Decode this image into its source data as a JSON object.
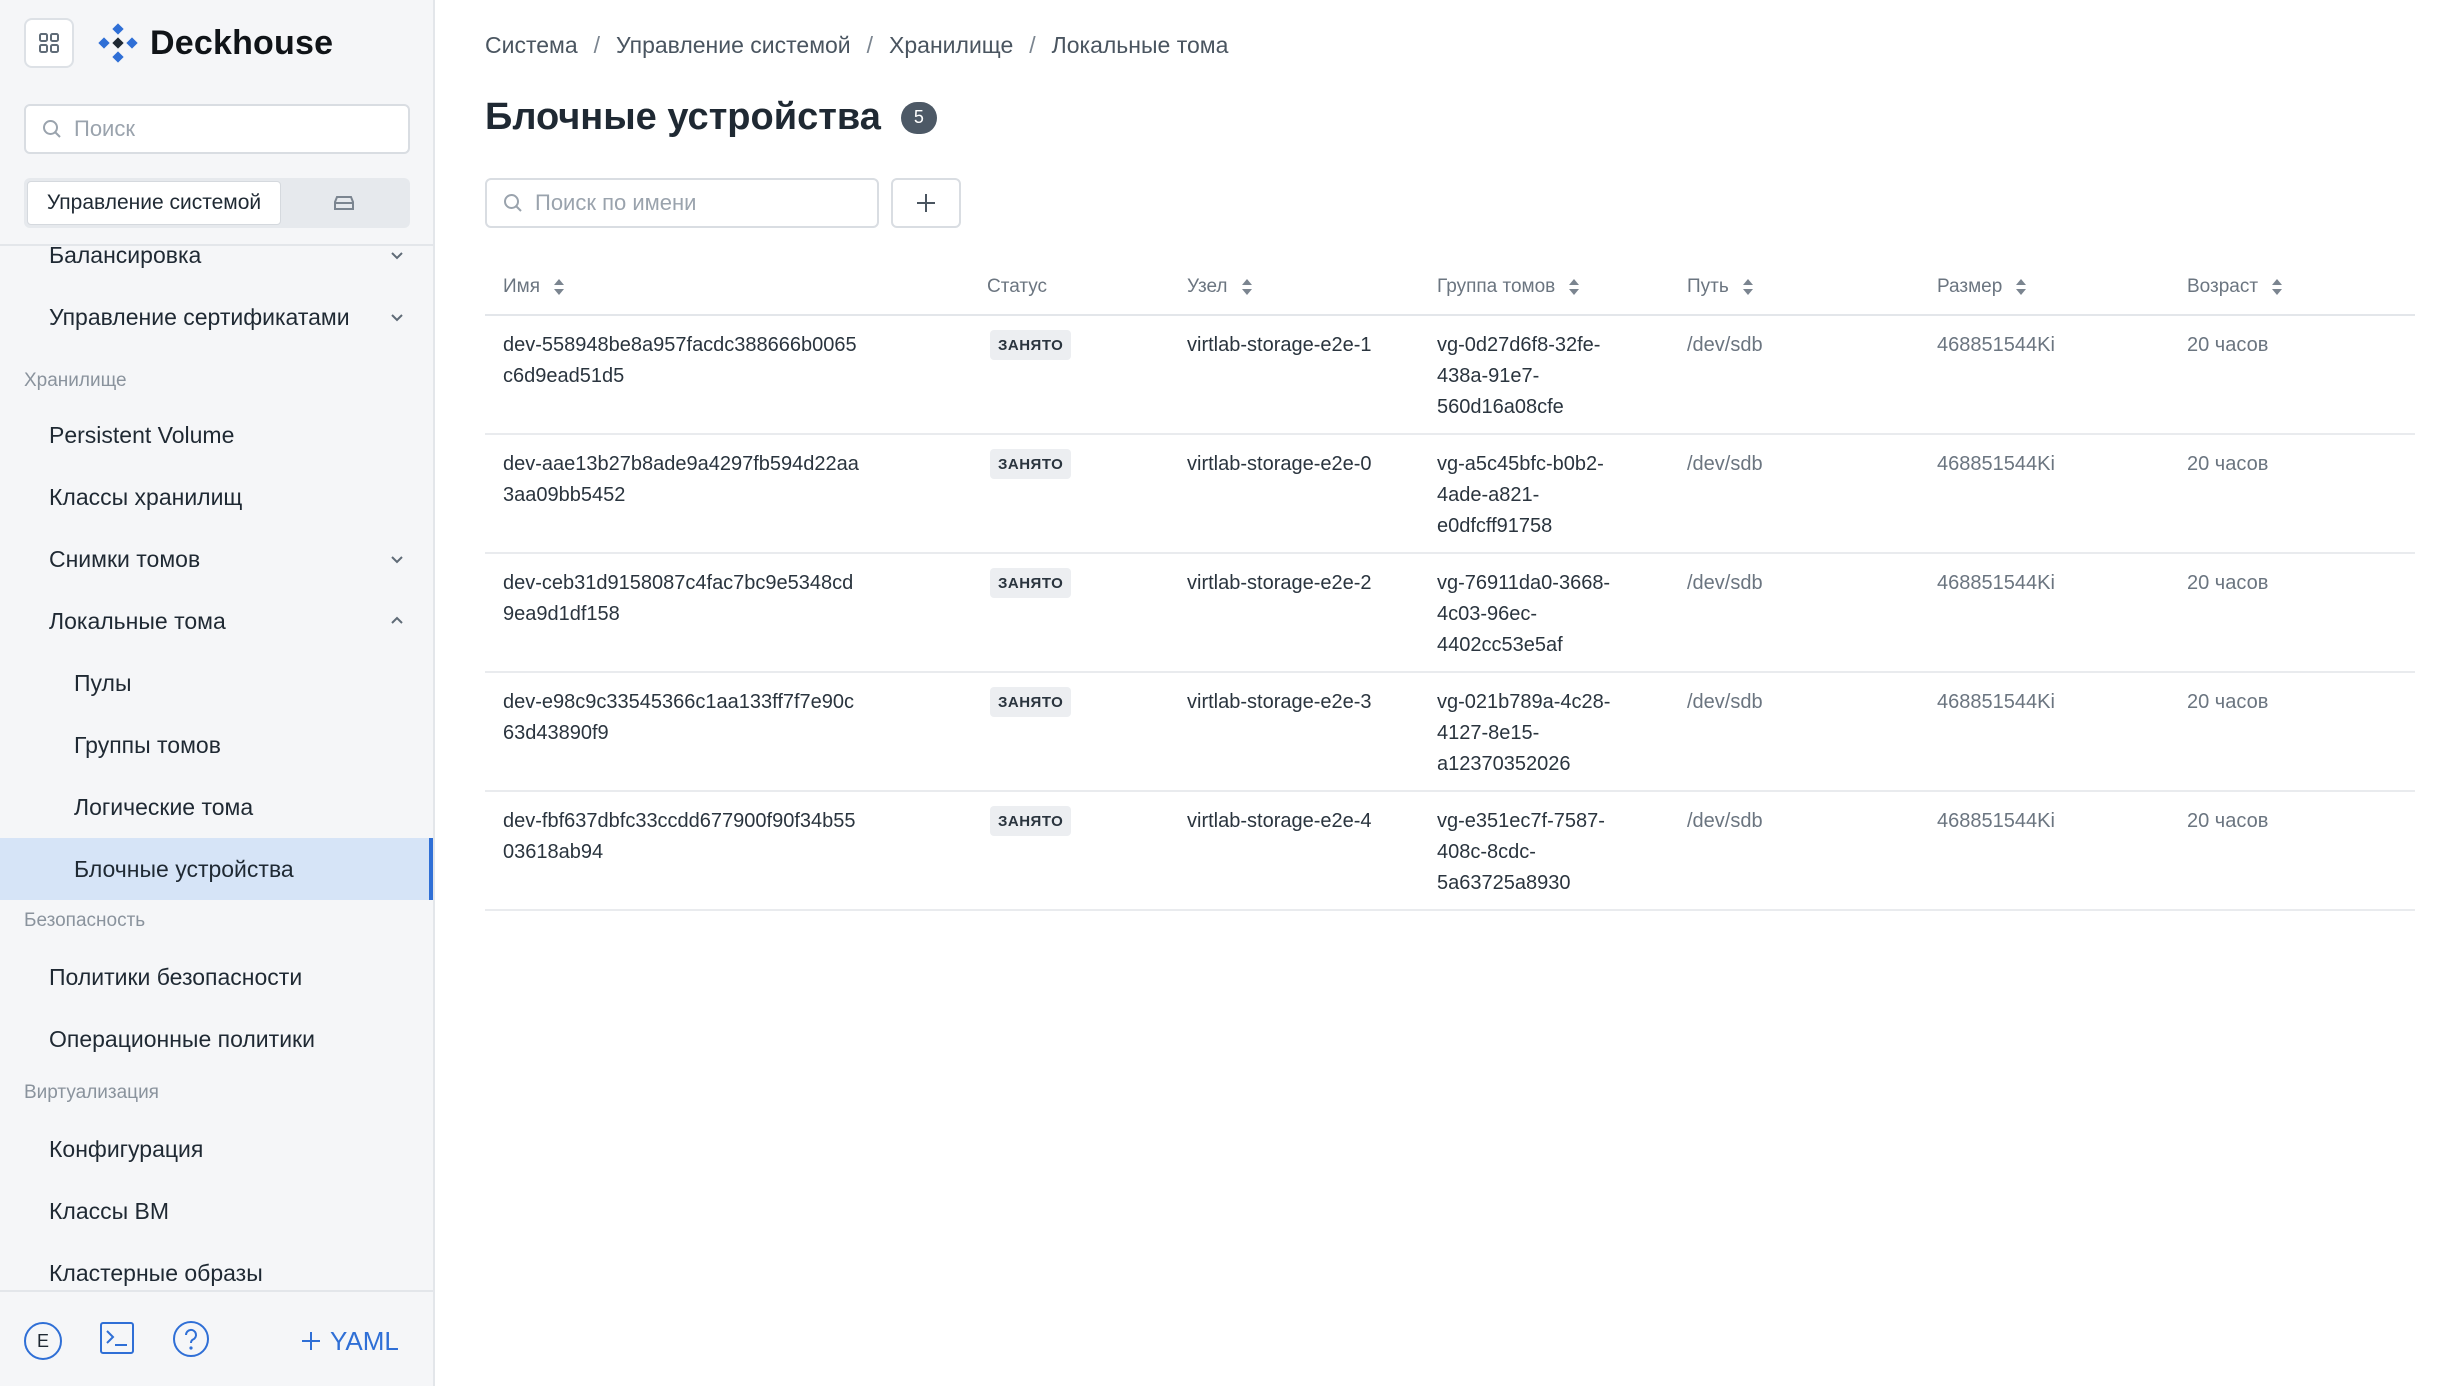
{
  "app": {
    "brand": "Deckhouse",
    "accent": "#2f6fd6"
  },
  "sidebar": {
    "search_placeholder": "Поиск",
    "segment": {
      "active_label": "Управление системой",
      "other_icon": "storage-icon"
    },
    "items": {
      "balancing": "Балансировка",
      "cert_mgmt": "Управление сертификатами",
      "section_storage": "Хранилище",
      "pv": "Persistent Volume",
      "storage_classes": "Классы хранилищ",
      "snapshots": "Снимки томов",
      "local_volumes": "Локальные тома",
      "pools": "Пулы",
      "volume_groups": "Группы томов",
      "logical_volumes": "Логические тома",
      "block_devices": "Блочные устройства",
      "section_security": "Безопасность",
      "security_policies": "Политики безопасности",
      "operational_policies": "Операционные политики",
      "section_virtualization": "Виртуализация",
      "configuration": "Конфигурация",
      "vm_classes": "Классы ВМ",
      "cluster_images": "Кластерные образы"
    },
    "bottom": {
      "avatar_letter": "E",
      "yaml_label": "YAML"
    }
  },
  "breadcrumb": [
    "Система",
    "Управление системой",
    "Хранилище",
    "Локальные тома"
  ],
  "page": {
    "title": "Блочные устройства",
    "count": "5"
  },
  "filter": {
    "placeholder": "Поиск по имени"
  },
  "table": {
    "columns": {
      "name": "Имя",
      "status": "Статус",
      "node": "Узел",
      "vg": "Группа томов",
      "path": "Путь",
      "size": "Размер",
      "age": "Возраст"
    },
    "rows": [
      {
        "name": "dev-558948be8a957facdc388666b0065c6d9ead51d5",
        "status": "ЗАНЯТО",
        "node": "virtlab-storage-e2e-1",
        "vg": "vg-0d27d6f8-32fe-438a-91e7-560d16a08cfe",
        "path": "/dev/sdb",
        "size": "468851544Ki",
        "age": "20 часов"
      },
      {
        "name": "dev-aae13b27b8ade9a4297fb594d22aa3aa09bb5452",
        "status": "ЗАНЯТО",
        "node": "virtlab-storage-e2e-0",
        "vg": "vg-a5c45bfc-b0b2-4ade-a821-e0dfcff91758",
        "path": "/dev/sdb",
        "size": "468851544Ki",
        "age": "20 часов"
      },
      {
        "name": "dev-ceb31d9158087c4fac7bc9e5348cd9ea9d1df158",
        "status": "ЗАНЯТО",
        "node": "virtlab-storage-e2e-2",
        "vg": "vg-76911da0-3668-4c03-96ec-4402cc53e5af",
        "path": "/dev/sdb",
        "size": "468851544Ki",
        "age": "20 часов"
      },
      {
        "name": "dev-e98c9c33545366c1aa133ff7f7e90c63d43890f9",
        "status": "ЗАНЯТО",
        "node": "virtlab-storage-e2e-3",
        "vg": "vg-021b789a-4c28-4127-8e15-a12370352026",
        "path": "/dev/sdb",
        "size": "468851544Ki",
        "age": "20 часов"
      },
      {
        "name": "dev-fbf637dbfc33ccdd677900f90f34b5503618ab94",
        "status": "ЗАНЯТО",
        "node": "virtlab-storage-e2e-4",
        "vg": "vg-e351ec7f-7587-408c-8cdc-5a63725a8930",
        "path": "/dev/sdb",
        "size": "468851544Ki",
        "age": "20 часов"
      }
    ]
  }
}
